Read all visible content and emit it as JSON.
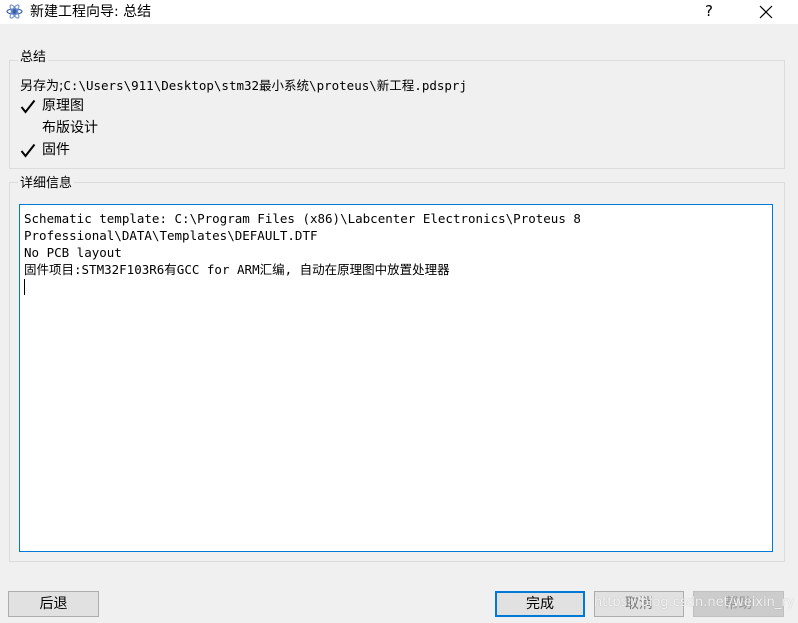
{
  "window": {
    "title": "新建工程向导: 总结",
    "help_label": "?"
  },
  "summary": {
    "group_title": "总结",
    "save_as_label": "另存为;",
    "save_as_path": "C:\\Users\\911\\Desktop\\stm32最小系统\\proteus\\新工程.pdsprj",
    "items": [
      {
        "label": "原理图",
        "checked": true
      },
      {
        "label": "布版设计",
        "checked": false
      },
      {
        "label": "固件",
        "checked": true
      }
    ]
  },
  "details": {
    "group_title": "详细信息",
    "text": "Schematic template: C:\\Program Files (x86)\\Labcenter Electronics\\Proteus 8\nProfessional\\DATA\\Templates\\DEFAULT.DTF\nNo PCB layout\n固件项目:STM32F103R6有GCC for ARM汇编, 自动在原理图中放置处理器"
  },
  "buttons": {
    "back": "后退",
    "finish": "完成",
    "cancel": "取消",
    "help": "帮助"
  },
  "watermark": "https://blog.csdn.net/weixin_ry",
  "colors": {
    "accent": "#0078d7",
    "background": "#f0f0f0"
  }
}
